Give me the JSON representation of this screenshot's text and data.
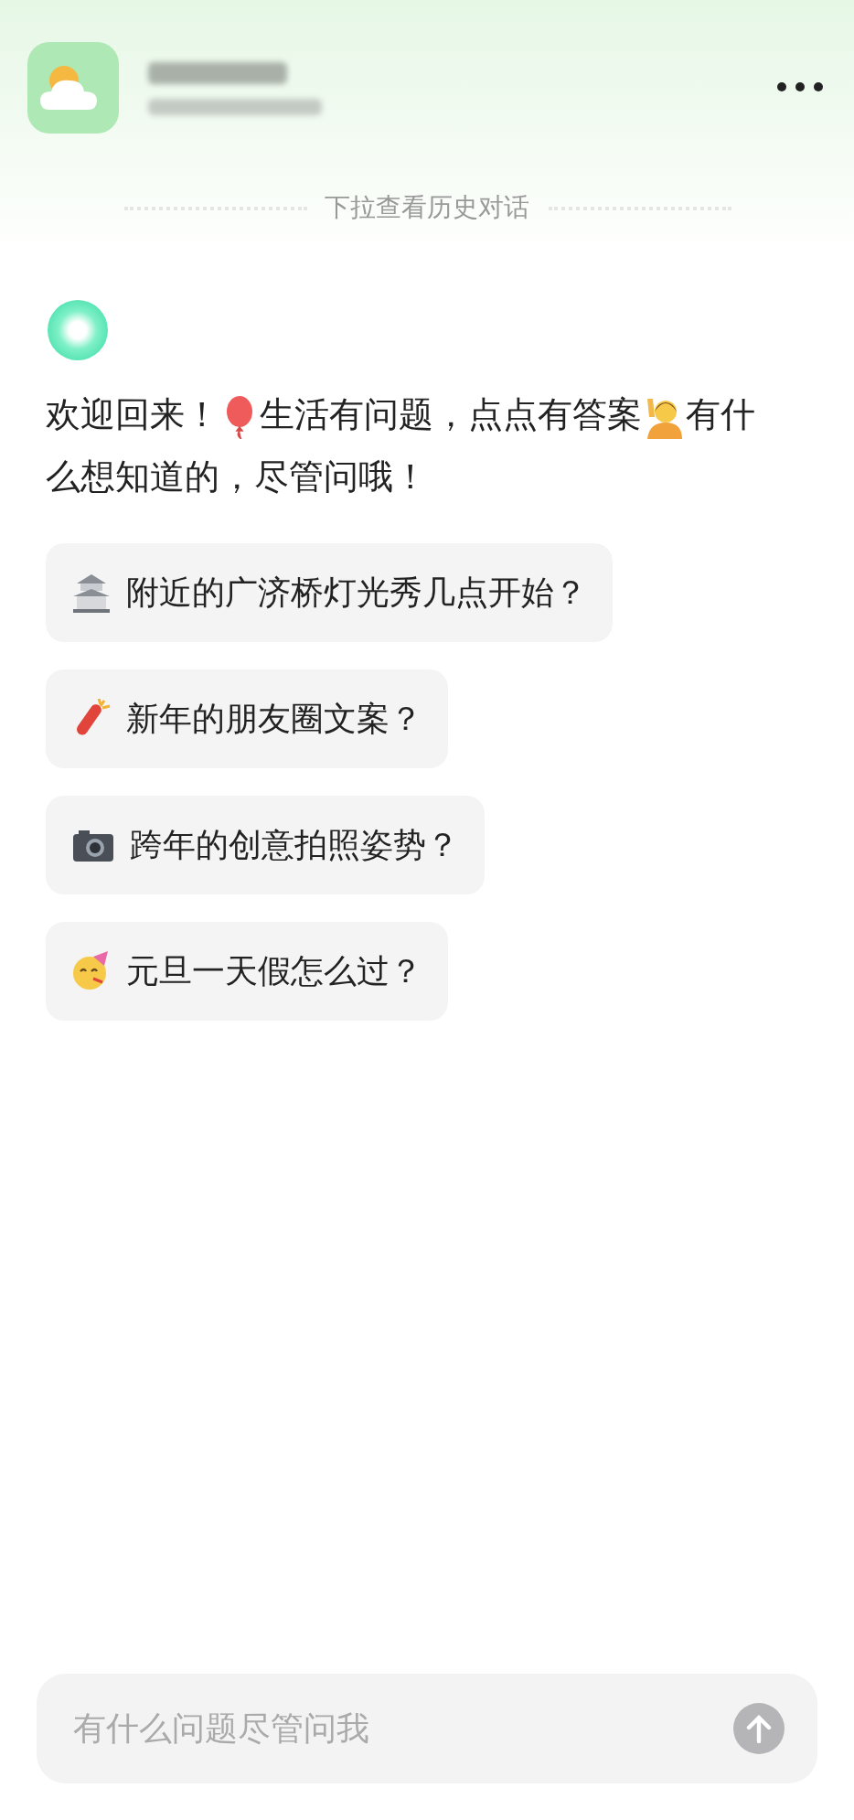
{
  "history_hint": "下拉查看历史对话",
  "welcome": [
    [
      {
        "kind": "text",
        "text": "欢迎回来！"
      },
      {
        "kind": "balloon"
      },
      {
        "kind": "text",
        "text": "生活有问题，点点有答案"
      },
      {
        "kind": "person"
      },
      {
        "kind": "text",
        "text": "有什"
      }
    ],
    [
      {
        "kind": "text",
        "text": "么想知道的，尽管问哦！"
      }
    ]
  ],
  "suggestions": [
    {
      "kind": "pagoda",
      "text": "附近的广济桥灯光秀几点开始？"
    },
    {
      "kind": "firecracker",
      "text": "新年的朋友圈文案？"
    },
    {
      "kind": "camera",
      "text": "跨年的创意拍照姿势？"
    },
    {
      "kind": "party",
      "text": "元旦一天假怎么过？"
    }
  ],
  "input": {
    "placeholder": "有什么问题尽管问我"
  }
}
